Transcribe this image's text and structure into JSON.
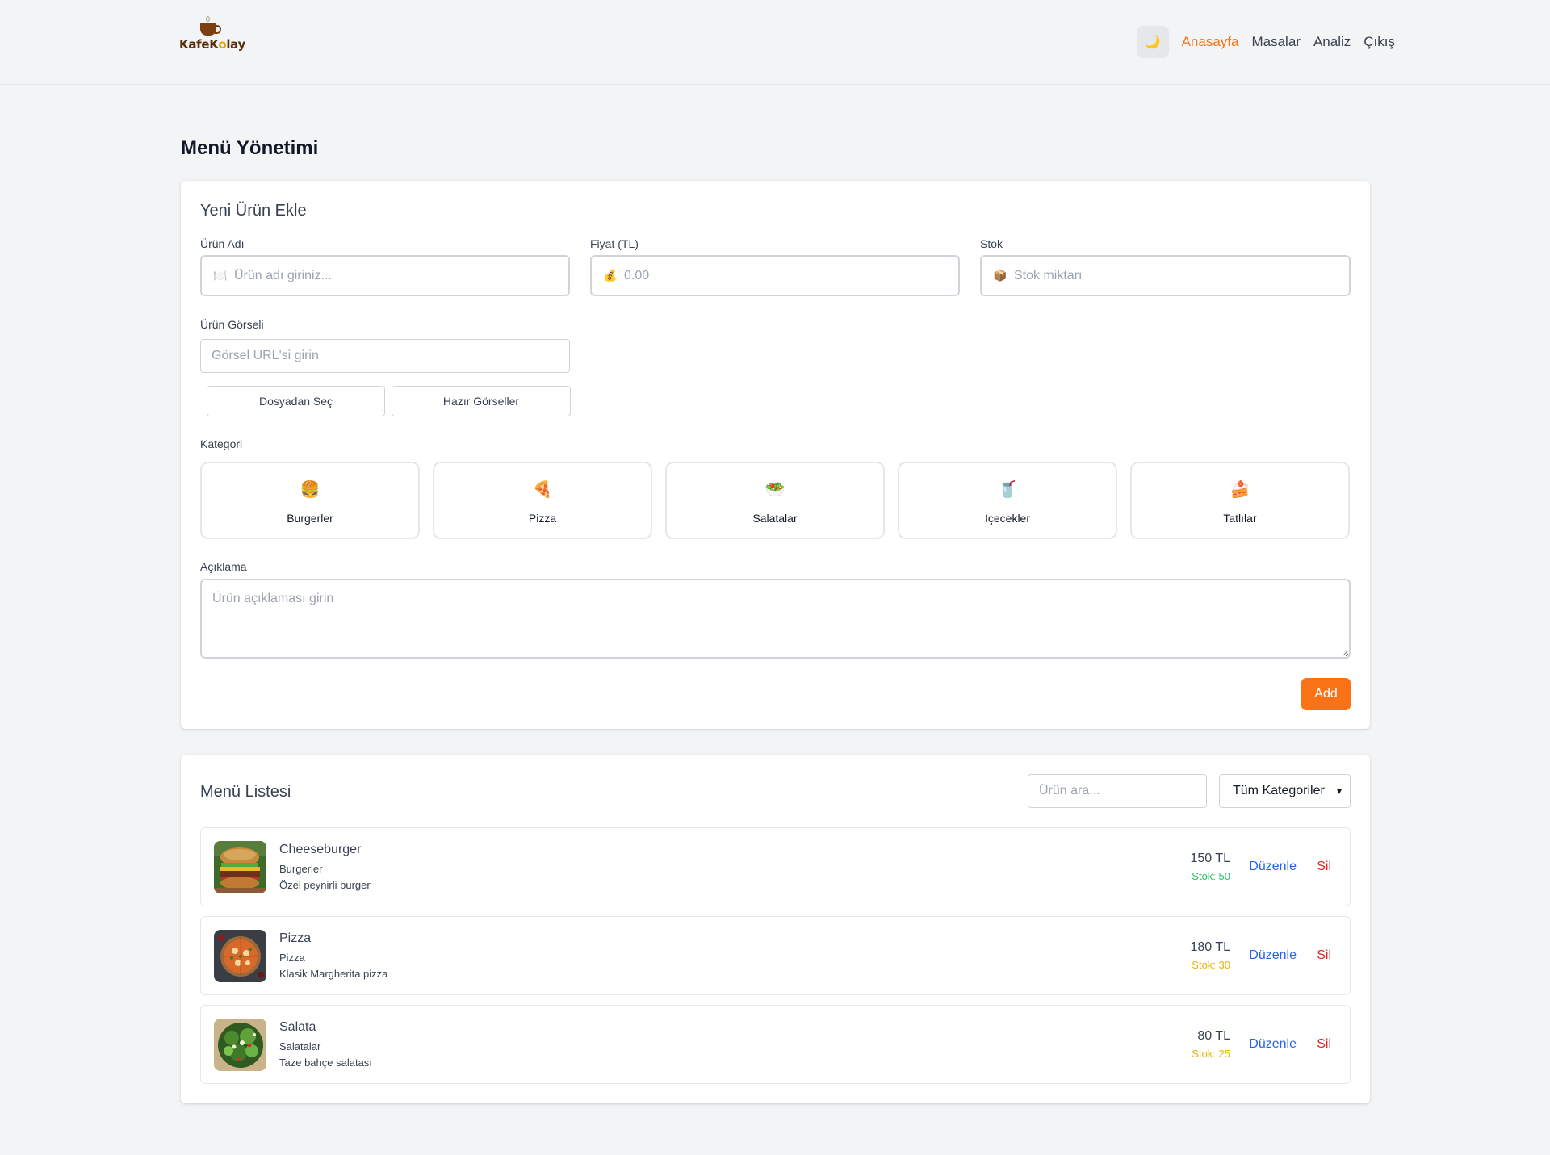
{
  "header": {
    "logo_text_a": "Kafe",
    "logo_text_b": "K",
    "logo_text_c": "o",
    "logo_text_d": "lay",
    "theme_toggle_icon": "🌙",
    "nav": [
      {
        "label": "Anasayfa",
        "active": true
      },
      {
        "label": "Masalar"
      },
      {
        "label": "Analiz"
      },
      {
        "label": "Çıkış"
      }
    ]
  },
  "page_title": "Menü Yönetimi",
  "add_form": {
    "title": "Yeni Ürün Ekle",
    "name_label": "Ürün Adı",
    "name_icon": "🍽️",
    "name_placeholder": "Ürün adı giriniz...",
    "price_label": "Fiyat (TL)",
    "price_icon": "💰",
    "price_placeholder": "0.00",
    "stock_label": "Stok",
    "stock_icon": "📦",
    "stock_placeholder": "Stok miktarı",
    "image_label": "Ürün Görseli",
    "image_placeholder": "Görsel URL'si girin",
    "file_button": "Dosyadan Seç",
    "preset_button": "Hazır Görseller",
    "category_label": "Kategori",
    "categories": [
      {
        "icon": "🍔",
        "label": "Burgerler"
      },
      {
        "icon": "🍕",
        "label": "Pizza"
      },
      {
        "icon": "🥗",
        "label": "Salatalar"
      },
      {
        "icon": "🥤",
        "label": "İçecekler"
      },
      {
        "icon": "🍰",
        "label": "Tatlılar"
      }
    ],
    "description_label": "Açıklama",
    "description_placeholder": "Ürün açıklaması girin",
    "add_button": "Add"
  },
  "menu_list": {
    "title": "Menü Listesi",
    "search_placeholder": "Ürün ara...",
    "category_filter": "Tüm Kategoriler",
    "edit_label": "Düzenle",
    "delete_label": "Sil",
    "items": [
      {
        "name": "Cheeseburger",
        "category": "Burgerler",
        "description": "Özel peynirli burger",
        "price": "150 TL",
        "stock": "Stok: 50",
        "stock_color": "#22c55e"
      },
      {
        "name": "Pizza",
        "category": "Pizza",
        "description": "Klasik Margherita pizza",
        "price": "180 TL",
        "stock": "Stok: 30",
        "stock_color": "#eab308"
      },
      {
        "name": "Salata",
        "category": "Salatalar",
        "description": "Taze bahçe salatası",
        "price": "80 TL",
        "stock": "Stok: 25",
        "stock_color": "#eab308"
      }
    ]
  }
}
